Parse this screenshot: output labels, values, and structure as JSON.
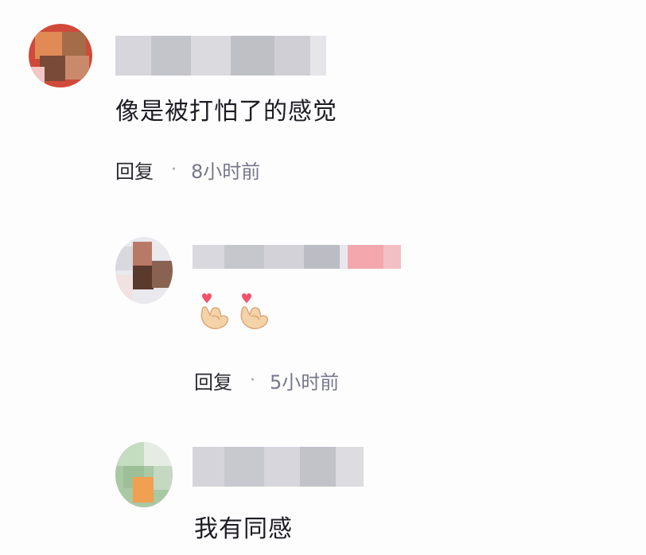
{
  "comments": [
    {
      "text": "像是被打怕了的感觉",
      "reply_label": "回复",
      "separator": "·",
      "time": "8小时前",
      "avatar_icon": "cartoon-avatar-red"
    },
    {
      "emojis": [
        "finger-heart-emoji",
        "finger-heart-emoji"
      ],
      "reply_label": "回复",
      "separator": "·",
      "time": "5小时前",
      "avatar_icon": "cartoon-avatar-brown"
    },
    {
      "text": "我有同感",
      "avatar_icon": "cartoon-avatar-green"
    }
  ],
  "colors": {
    "background": "#fdfdfe",
    "blur_gray": "#c9c9d0",
    "blur_pink": "#f4a8ae"
  }
}
